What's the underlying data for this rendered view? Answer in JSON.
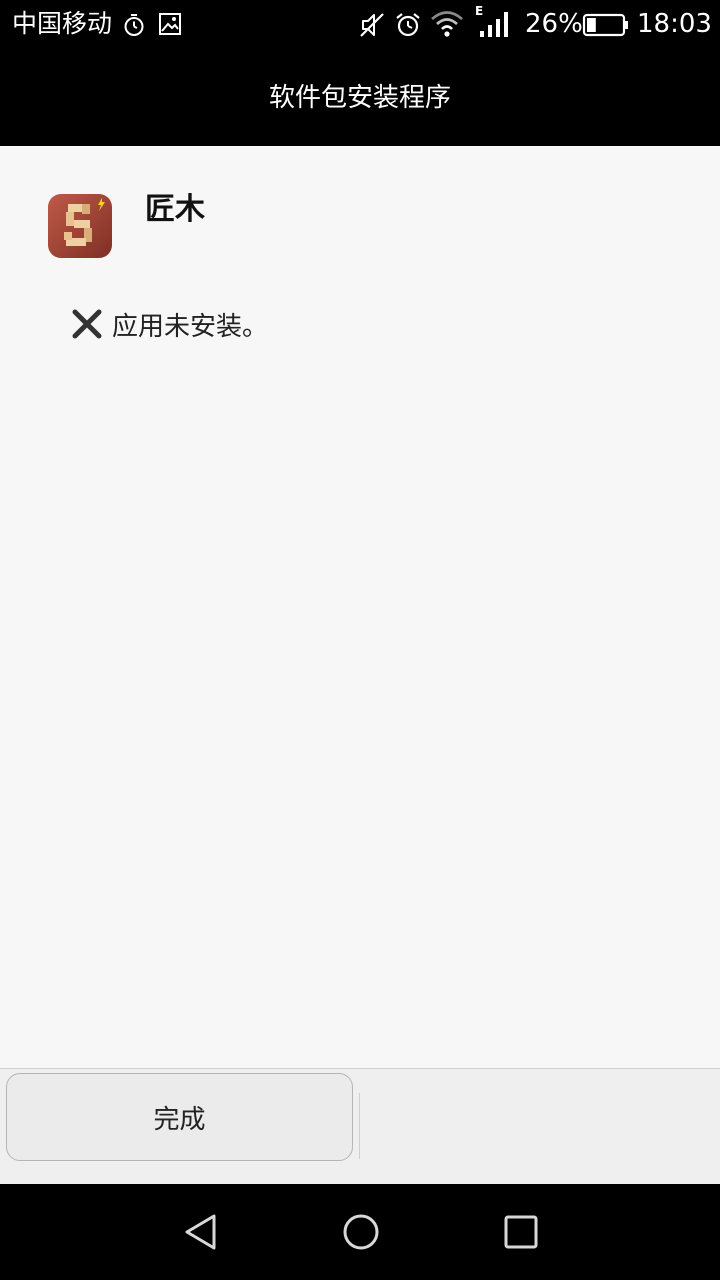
{
  "status_bar": {
    "carrier": "中国移动",
    "network_type": "E",
    "battery_percent": "26%",
    "battery_level": 0.26,
    "time": "18:03",
    "icons": [
      "stopwatch-icon",
      "gallery-icon",
      "mute-icon",
      "alarm-icon",
      "wifi-icon",
      "cellular-signal-icon",
      "battery-icon"
    ]
  },
  "action_bar": {
    "title": "软件包安装程序"
  },
  "app": {
    "name": "匠木",
    "icon": "app-icon-jiangmu"
  },
  "install_status": {
    "icon": "close-x-icon",
    "message": "应用未安装。"
  },
  "buttons": {
    "done_label": "完成"
  },
  "nav_bar": {
    "icons": [
      "back-triangle-icon",
      "home-circle-icon",
      "recent-square-icon"
    ]
  },
  "colors": {
    "bar_background": "#000000",
    "content_background": "#f7f7f7",
    "button_bar_background": "#efefef",
    "app_icon_red": "#a8473a"
  }
}
